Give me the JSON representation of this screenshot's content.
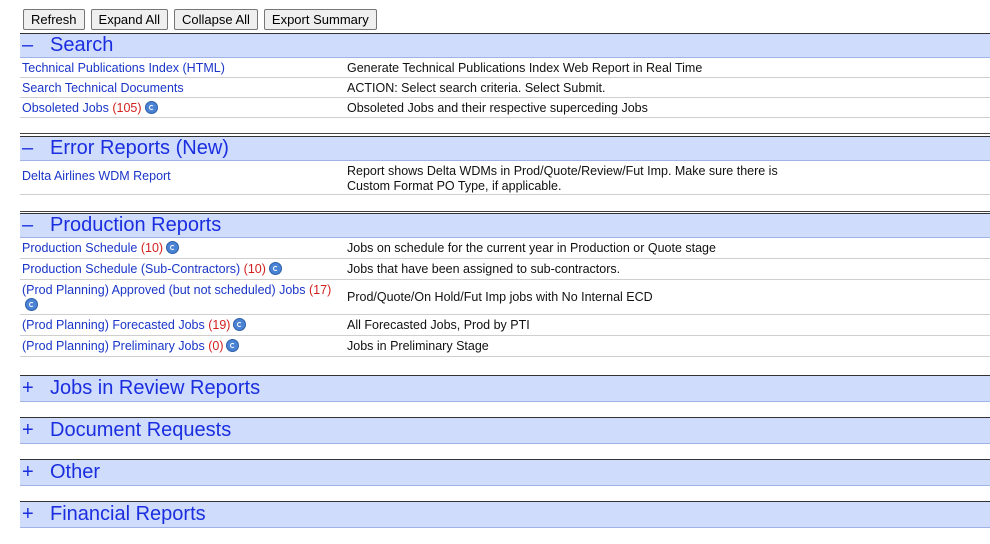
{
  "toolbar": {
    "refresh": "Refresh",
    "expand_all": "Expand All",
    "collapse_all": "Collapse All",
    "export_summary": "Export Summary"
  },
  "sections": {
    "search": {
      "toggle": "–",
      "title": "Search",
      "rows": [
        {
          "link": "Technical Publications Index (HTML)",
          "count": "",
          "desc": "Generate Technical Publications Index Web Report in Real Time"
        },
        {
          "link": "Search Technical Documents",
          "count": "",
          "desc": "ACTION: Select search criteria. Select Submit."
        },
        {
          "link": "Obsoleted Jobs",
          "count": "(105)",
          "desc": "Obsoleted Jobs and their respective superceding Jobs"
        }
      ]
    },
    "error": {
      "toggle": "–",
      "title": "Error Reports (New)",
      "rows": [
        {
          "link": "Delta Airlines WDM Report",
          "count": "",
          "desc": "Report shows Delta WDMs in Prod/Quote/Review/Fut Imp. Make sure there is Custom Format PO Type, if applicable."
        }
      ]
    },
    "production": {
      "toggle": "–",
      "title": "Production Reports",
      "rows": [
        {
          "link": "Production Schedule",
          "count": "(10)",
          "desc": "Jobs on schedule for the current year in Production or Quote stage"
        },
        {
          "link": "Production Schedule (Sub-Contractors)",
          "count": "(10)",
          "desc": "Jobs that have been assigned to sub-contractors."
        },
        {
          "link": "(Prod Planning) Approved (but not scheduled) Jobs",
          "count": "(17)",
          "desc": "Prod/Quote/On Hold/Fut Imp jobs with No Internal ECD"
        },
        {
          "link": "(Prod Planning) Forecasted Jobs",
          "count": "(19)",
          "desc": "All Forecasted Jobs, Prod by PTI"
        },
        {
          "link": "(Prod Planning) Preliminary Jobs",
          "count": "(0)",
          "desc": "Jobs in Preliminary Stage"
        }
      ]
    },
    "review": {
      "toggle": "+",
      "title": "Jobs in Review Reports"
    },
    "document": {
      "toggle": "+",
      "title": "Document Requests"
    },
    "other": {
      "toggle": "+",
      "title": "Other"
    },
    "financial": {
      "toggle": "+",
      "title": "Financial Reports"
    }
  },
  "colors": {
    "header_bg": "#cfdcfc",
    "header_text": "#1a2ee0",
    "link": "#1a35c8",
    "count": "#d21f1f"
  }
}
